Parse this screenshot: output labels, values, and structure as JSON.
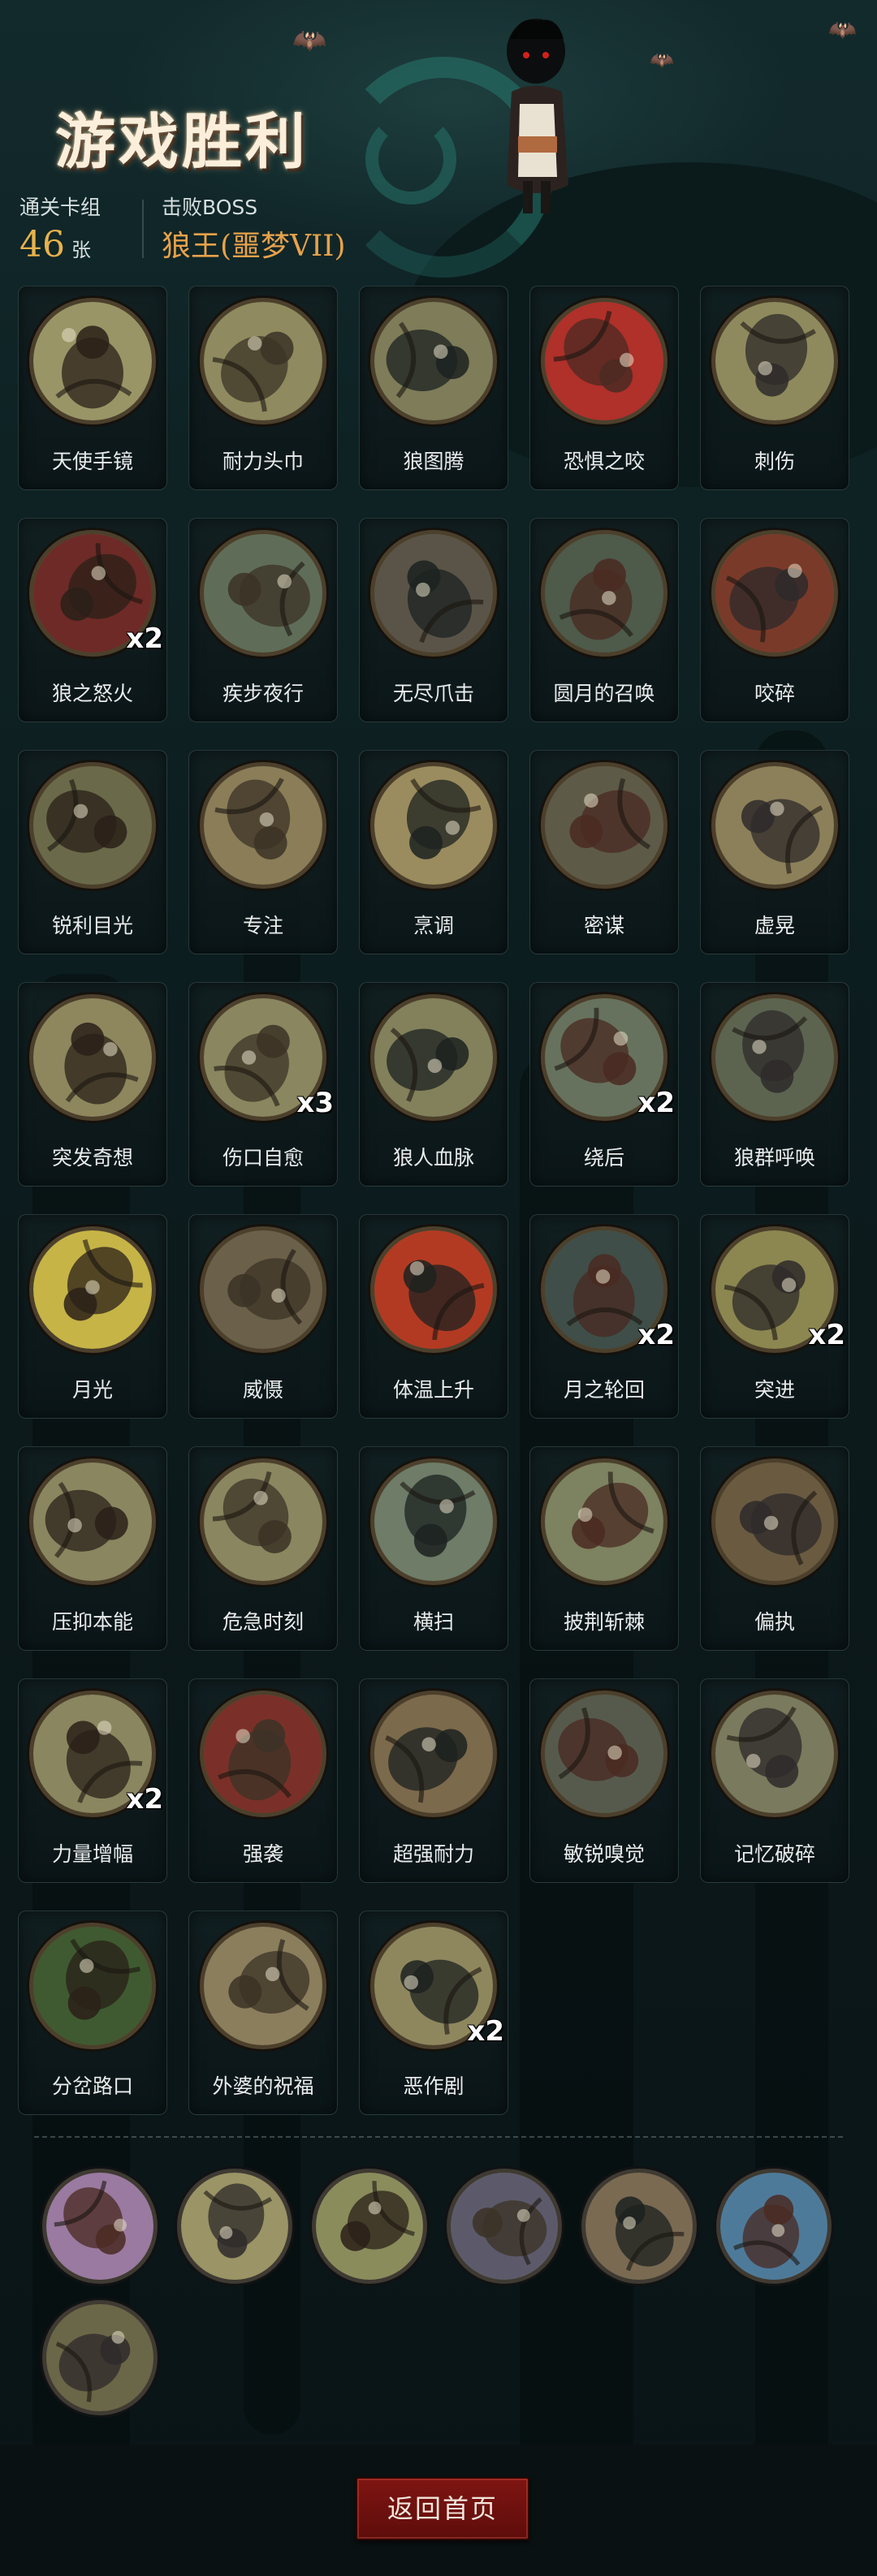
{
  "header": {
    "title": "游戏胜利",
    "deck_label": "通关卡组",
    "deck_count": "46",
    "deck_unit": "张",
    "boss_label": "击败BOSS",
    "boss_name": "狼王(噩梦VII)"
  },
  "cards": [
    {
      "name": "天使手镜",
      "count": "",
      "icon": "hand-mirror-icon",
      "tint": "#9a9567"
    },
    {
      "name": "耐力头巾",
      "count": "",
      "icon": "bandana-icon",
      "tint": "#8f8a5f"
    },
    {
      "name": "狼图腾",
      "count": "",
      "icon": "wolf-totem-icon",
      "tint": "#7e7c59"
    },
    {
      "name": "恐惧之咬",
      "count": "",
      "icon": "fear-bite-icon",
      "tint": "#b0302a"
    },
    {
      "name": "刺伤",
      "count": "",
      "icon": "stab-icon",
      "tint": "#8e8a5e"
    },
    {
      "name": "狼之怒火",
      "count": "x2",
      "icon": "wolf-rage-icon",
      "tint": "#6e2a26"
    },
    {
      "name": "疾步夜行",
      "count": "",
      "icon": "night-dash-icon",
      "tint": "#5f6d58"
    },
    {
      "name": "无尽爪击",
      "count": "",
      "icon": "endless-claw-icon",
      "tint": "#5a5448"
    },
    {
      "name": "圆月的召唤",
      "count": "",
      "icon": "full-moon-call-icon",
      "tint": "#4e5a4a"
    },
    {
      "name": "咬碎",
      "count": "",
      "icon": "crush-bite-icon",
      "tint": "#7a3a2a"
    },
    {
      "name": "锐利目光",
      "count": "",
      "icon": "sharp-gaze-icon",
      "tint": "#6a6a4a"
    },
    {
      "name": "专注",
      "count": "",
      "icon": "focus-icon",
      "tint": "#8a7d58"
    },
    {
      "name": "烹调",
      "count": "",
      "icon": "cooking-icon",
      "tint": "#9a8c5e"
    },
    {
      "name": "密谋",
      "count": "",
      "icon": "conspiracy-icon",
      "tint": "#5e5a48"
    },
    {
      "name": "虚晃",
      "count": "",
      "icon": "feint-icon",
      "tint": "#8c805a"
    },
    {
      "name": "突发奇想",
      "count": "",
      "icon": "sudden-idea-icon",
      "tint": "#8e875e"
    },
    {
      "name": "伤口自愈",
      "count": "x3",
      "icon": "wound-heal-icon",
      "tint": "#8a8660"
    },
    {
      "name": "狼人血脉",
      "count": "",
      "icon": "werewolf-blood-icon",
      "tint": "#83815b"
    },
    {
      "name": "绕后",
      "count": "x2",
      "icon": "flank-icon",
      "tint": "#66725e"
    },
    {
      "name": "狼群呼唤",
      "count": "",
      "icon": "pack-call-icon",
      "tint": "#5c6450"
    },
    {
      "name": "月光",
      "count": "",
      "icon": "moonlight-icon",
      "tint": "#c6b447"
    },
    {
      "name": "威慑",
      "count": "",
      "icon": "deterrence-icon",
      "tint": "#6b6049"
    },
    {
      "name": "体温上升",
      "count": "",
      "icon": "fever-icon",
      "tint": "#b23a22"
    },
    {
      "name": "月之轮回",
      "count": "x2",
      "icon": "moon-cycle-icon",
      "tint": "#3f4e48"
    },
    {
      "name": "突进",
      "count": "x2",
      "icon": "charge-icon",
      "tint": "#8c8750"
    },
    {
      "name": "压抑本能",
      "count": "",
      "icon": "suppress-instinct-icon",
      "tint": "#8a8660"
    },
    {
      "name": "危急时刻",
      "count": "",
      "icon": "crisis-moment-icon",
      "tint": "#8a8660"
    },
    {
      "name": "横扫",
      "count": "",
      "icon": "sweep-icon",
      "tint": "#6e7c68"
    },
    {
      "name": "披荆斩棘",
      "count": "",
      "icon": "thorn-cleave-icon",
      "tint": "#7d8260"
    },
    {
      "name": "偏执",
      "count": "",
      "icon": "paranoia-icon",
      "tint": "#6a5a40"
    },
    {
      "name": "力量增幅",
      "count": "x2",
      "icon": "power-boost-icon",
      "tint": "#8a8660"
    },
    {
      "name": "强袭",
      "count": "",
      "icon": "assault-icon",
      "tint": "#7a3028"
    },
    {
      "name": "超强耐力",
      "count": "",
      "icon": "super-stamina-icon",
      "tint": "#7c6a4c"
    },
    {
      "name": "敏锐嗅觉",
      "count": "",
      "icon": "keen-smell-icon",
      "tint": "#565a4c"
    },
    {
      "name": "记忆破碎",
      "count": "",
      "icon": "shattered-memory-icon",
      "tint": "#7a7a5e"
    },
    {
      "name": "分岔路口",
      "count": "",
      "icon": "crossroads-icon",
      "tint": "#3f5a30"
    },
    {
      "name": "外婆的祝福",
      "count": "",
      "icon": "grandma-blessing-icon",
      "tint": "#8a7e5c"
    },
    {
      "name": "恶作剧",
      "count": "x2",
      "icon": "prank-icon",
      "tint": "#8e875e"
    }
  ],
  "relics": [
    {
      "icon": "twisted-creature-relic-icon",
      "tint": "#9a7aa0"
    },
    {
      "icon": "flame-potion-relic-icon",
      "tint": "#9a9466"
    },
    {
      "icon": "forest-fighter-relic-icon",
      "tint": "#8a8c5c"
    },
    {
      "icon": "vampire-relic-icon",
      "tint": "#5c5a6a"
    },
    {
      "icon": "red-hood-relic-icon",
      "tint": "#7a6a52"
    },
    {
      "icon": "magic-compass-relic-icon",
      "tint": "#4e7a9a"
    },
    {
      "icon": "pumpkin-scarecrow-relic-icon",
      "tint": "#6a6648"
    }
  ],
  "footer": {
    "home_button": "返回首页"
  }
}
